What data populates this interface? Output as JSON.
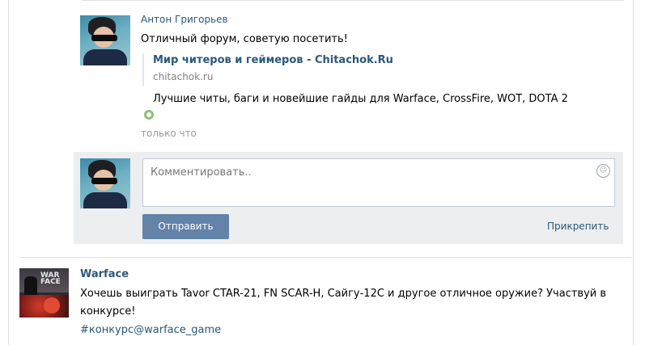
{
  "post": {
    "author": "Антон Григорьев",
    "text": "Отличный форум, советую посетить!",
    "link": {
      "title": "Мир читеров и геймеров - Chitachok.Ru",
      "domain": "chitachok.ru",
      "description": "Лучшие читы, баги и новейшие гайды для Warface, CrossFire, WOT, DOTA 2"
    },
    "time": "только что"
  },
  "comment_form": {
    "placeholder": "Комментировать..",
    "send_label": "Отправить",
    "attach_label": "Прикрепить"
  },
  "next_post": {
    "group": "Warface",
    "logo_text": "WAR FACE",
    "text_line1": "Хочешь выиграть Tavor CTAR-21, FN SCAR-H, Сайгу-12С и другое отличное оружие? Участвуй в",
    "text_line2": "конкурсе!",
    "hashtag": "#конкурс@warface_game"
  },
  "icons": [
    "user-avatar",
    "online-indicator-icon",
    "smile-icon",
    "warface-logo"
  ],
  "colors": {
    "link": "#2b587a",
    "button": "#6383a8",
    "online": "#8ac176",
    "comment_bg": "#edeef0"
  }
}
